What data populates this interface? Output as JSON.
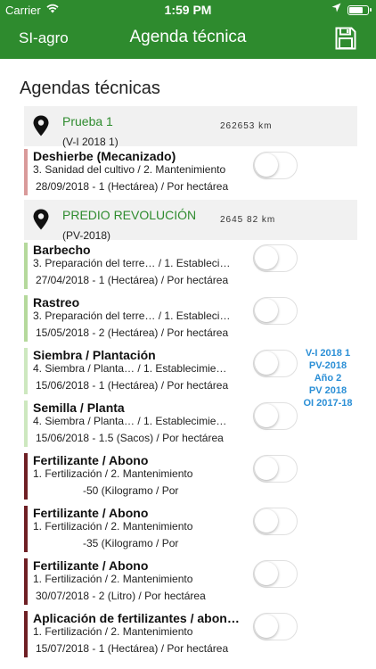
{
  "status_bar": {
    "carrier": "Carrier",
    "time": "1:59 PM"
  },
  "nav": {
    "back_label": "SI-agro",
    "title": "Agenda técnica"
  },
  "section_title": "Agendas técnicas",
  "groups": [
    {
      "name": "Prueba 1",
      "code": "(V-I   2018 1)",
      "distance": "262653 km"
    },
    {
      "name": "PREDIO REVOLUCIÓN",
      "code": "(PV-2018)",
      "distance": "2645 82 km"
    }
  ],
  "items": [
    {
      "name": "Deshierbe (Mecanizado)",
      "path": "3. Sanidad del cultivo  /  2. Mantenimiento",
      "detail": "28/09/2018 - 1  (Hectárea) / Por hectárea",
      "color": "#d99a9a"
    },
    {
      "name": "Barbecho",
      "path": "3. Preparación del terre…  /  1. Estableci…",
      "detail": "27/04/2018 - 1  (Hectárea) / Por hectárea",
      "color": "#b5d99c"
    },
    {
      "name": "Rastreo",
      "path": "3. Preparación del terre…  /  1. Estableci…",
      "detail": "15/05/2018 - 2  (Hectárea) / Por hectárea",
      "color": "#b5d99c"
    },
    {
      "name": "Siembra / Plantación",
      "path": "4. Siembra / Planta…    /  1. Establecimie…",
      "detail": "15/06/2018 - 1  (Hectárea) / Por hectárea",
      "color": "#cde8bf"
    },
    {
      "name": "Semilla / Planta",
      "path": "4. Siembra / Planta…    /  1. Establecimie…",
      "detail": "15/06/2018 - 1.5  (Sacos) / Por hectárea",
      "color": "#cde8bf"
    },
    {
      "name": "Fertilizante / Abono",
      "path": "1. Fertilización  /  2. Mantenimiento",
      "detail": "-50    (Kilogramo / Por",
      "color": "#6e1f24"
    },
    {
      "name": "Fertilizante / Abono",
      "path": "1. Fertilización  /  2. Mantenimiento",
      "detail": "-35    (Kilogramo / Por",
      "color": "#6e1f24"
    },
    {
      "name": "Fertilizante / Abono",
      "path": "1. Fertilización  /  2. Mantenimiento",
      "detail": "30/07/2018 - 2  (Litro) / Por hectárea",
      "color": "#6e1f24"
    },
    {
      "name": "Aplicación de fertilizantes / abon…",
      "path": "1. Fertilización  /  2. Mantenimiento",
      "detail": "15/07/2018 - 1  (Hectárea) / Por hectárea",
      "color": "#6e1f24"
    }
  ],
  "side_index": [
    "V-I   2018 1",
    "PV-2018",
    "Año 2",
    "PV 2018",
    "OI 2017-18"
  ],
  "colors": {
    "brand_green": "#2e8b2e",
    "index_blue": "#2b8fd6"
  },
  "icons": [
    "wifi-icon",
    "location-arrow-icon",
    "battery-icon",
    "save-floppy-icon",
    "map-pin-icon"
  ]
}
